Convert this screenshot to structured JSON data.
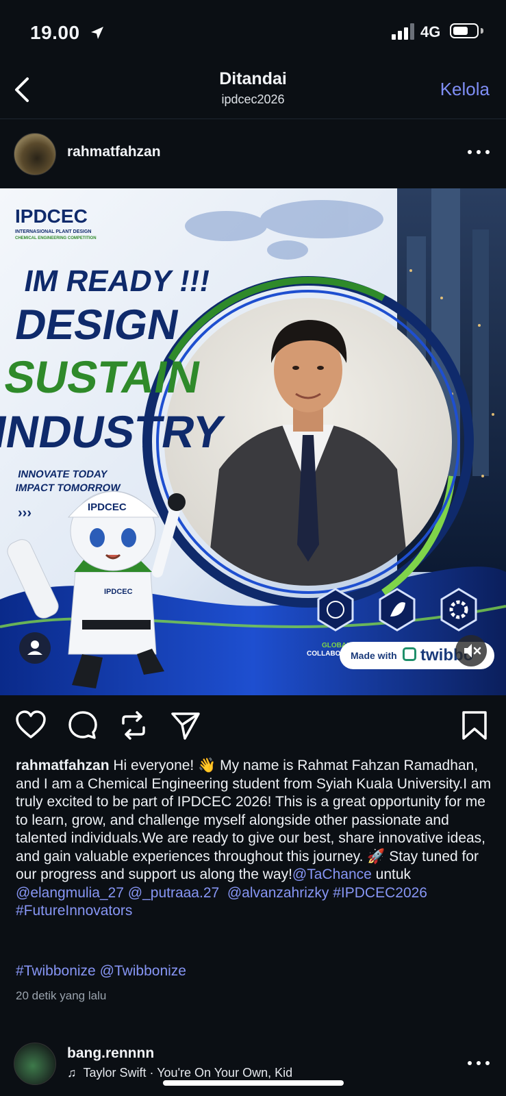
{
  "status": {
    "time": "19.00",
    "network": "4G"
  },
  "nav": {
    "title": "Ditandai",
    "subtitle": "ipdcec2026",
    "action": "Kelola"
  },
  "post": {
    "username": "rahmatfahzan",
    "image": {
      "logo": "IPDCEC",
      "logo_sub1": "INTERNASIONAL PLANT DESIGN",
      "logo_sub2": "CHEMICAL ENGINEERING COMPETITION",
      "line1": "IM READY !!!",
      "line2": "DESIGN",
      "line3": "SUSTAIN",
      "line4": "INDUSTRY",
      "tag1": "INNOVATE TODAY",
      "tag2": "IMPACT TOMORROW",
      "mascot_badge": "IPDCEC",
      "mascot_chest": "IPDCEC",
      "icon_label1": "GLOBAL",
      "icon_label1b": "COLLABO",
      "made_with": "Made with",
      "made_brand": "twibbo"
    },
    "caption": {
      "username": "rahmatfahzan",
      "text": "Hi everyone! 👋 My name is Rahmat Fahzan Ramadhan, and I am a Chemical Engineering student from Syiah Kuala University.I am truly excited to be part of IPDCEC 2026! This is a great opportunity for me to learn, grow, and challenge myself alongside other passionate and talented individuals.We are ready to give our best, share innovative ideas, and gain valuable experiences throughout this journey. 🚀 Stay tuned for our progress and support us along the way!",
      "mention1": "@TaChance",
      "connector": " untuk ",
      "mention2": "@elangmulia_27",
      "mention3": "@_putraaa.27",
      "mention4": "@alvanzahrizky",
      "hashtag1": "#IPDCEC2026",
      "hashtag2": "#FutureInnovators",
      "hashtag3": "#Twibbonize",
      "mention5": "@Twibbonize"
    },
    "time_ago": "20 detik yang lalu"
  },
  "next_post": {
    "username": "bang.rennnn",
    "music": "Taylor Swift · You're On Your Own, Kid"
  },
  "colors": {
    "accent_link": "#8796f5",
    "background": "#0b0f14",
    "navy": "#0f2a6b",
    "green": "#2f8a2a"
  }
}
